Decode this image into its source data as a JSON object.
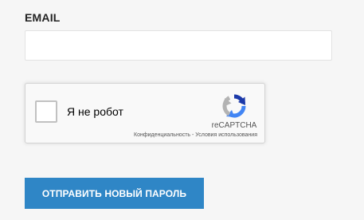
{
  "form": {
    "email_label": "EMAIL",
    "email_value": "",
    "email_placeholder": "",
    "submit_label": "ОТПРАВИТЬ НОВЫЙ ПАРОЛЬ"
  },
  "recaptcha": {
    "checkbox_label": "Я не робот",
    "checked": false,
    "brand": "reCAPTCHA",
    "privacy_link": "Конфиденциальность",
    "separator": " - ",
    "terms_link": "Условия использования",
    "logo_icon": "recaptcha-logo-icon"
  },
  "colors": {
    "page_background": "#f6f6f6",
    "button_background": "#2f86c6",
    "button_text": "#ffffff",
    "recaptcha_blue_dark": "#1c3aa9",
    "recaptcha_blue": "#4285f4",
    "recaptcha_gray": "#b3b3b3"
  }
}
